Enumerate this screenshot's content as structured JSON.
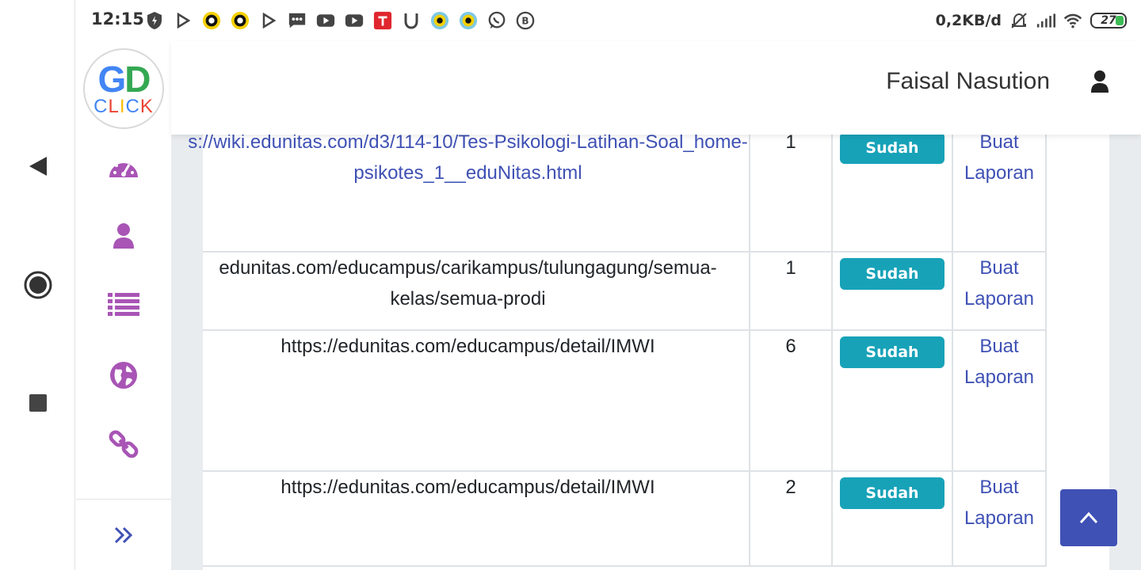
{
  "status_bar": {
    "time": "12:15",
    "speed": "0,2KB/d",
    "battery": "27",
    "icons": [
      "shield-bolt-icon",
      "play-store-icon",
      "snack-icon",
      "snack-icon",
      "play-store-icon",
      "message-icon",
      "youtube-icon",
      "youtube-icon",
      "telkomsel-icon",
      "u-icon",
      "snack-icon",
      "snack-icon",
      "whatsapp-icon",
      "b-icon"
    ]
  },
  "header": {
    "user_name": "Faisal Nasution"
  },
  "logo": {
    "line1": "GD",
    "line2": "CLICK"
  },
  "sidebar": {
    "icons": [
      "dashboard-icon",
      "user-icon",
      "list-icon",
      "globe-icon",
      "link-icon"
    ],
    "expand_icon": "double-chevron-right-icon"
  },
  "table": {
    "rows": [
      {
        "url": "s://wiki.edunitas.com/d3/114-10/Tes-Psikologi-Latihan-Soal_home-psikotes_1__eduNitas.html",
        "is_link": true,
        "count": "1",
        "status": "Sudah",
        "action": "Buat Laporan"
      },
      {
        "url": "edunitas.com/educampus/carikampus/tulungagung/semua-kelas/semua-prodi",
        "is_link": false,
        "count": "1",
        "status": "Sudah",
        "action": "Buat Laporan"
      },
      {
        "url": "https://edunitas.com/educampus/detail/IMWI",
        "is_link": false,
        "count": "6",
        "status": "Sudah",
        "action": "Buat Laporan"
      },
      {
        "url": "https://edunitas.com/educampus/detail/IMWI",
        "is_link": false,
        "count": "2",
        "status": "Sudah",
        "action": "Buat Laporan"
      }
    ]
  },
  "colors": {
    "accent": "#3f51b5",
    "badge": "#17a2b8",
    "sidebar_icon": "#a855b5"
  }
}
